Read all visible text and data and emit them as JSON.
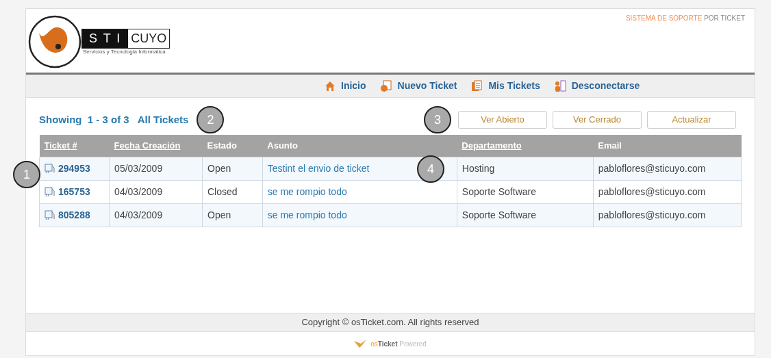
{
  "header": {
    "logo": {
      "letters": "S T I",
      "name": "CUYO",
      "tagline": "Servicios y Tecnologia Informatica"
    },
    "tagline_highlight": "SISTEMA DE SOPORTE",
    "tagline_rest": "POR TICKET"
  },
  "nav": [
    {
      "label": "Inicio"
    },
    {
      "label": "Nuevo Ticket"
    },
    {
      "label": "Mis Tickets"
    },
    {
      "label": "Desconectarse"
    }
  ],
  "summary": {
    "prefix": "Showing",
    "range": "1 - 3 of 3",
    "filter": "All Tickets"
  },
  "buttons": [
    "Ver Abierto",
    "Ver Cerrado",
    "Actualizar"
  ],
  "table": {
    "columns": [
      {
        "label": "Ticket #",
        "sortable": true
      },
      {
        "label": "Fecha Creación",
        "sortable": true
      },
      {
        "label": "Estado",
        "sortable": false
      },
      {
        "label": "Asunto",
        "sortable": false
      },
      {
        "label": "Departamento",
        "sortable": true
      },
      {
        "label": "Email",
        "sortable": false
      }
    ],
    "rows": [
      {
        "ticket": "294953",
        "date": "05/03/2009",
        "status": "Open",
        "subject": "Testint el envio de ticket",
        "department": "Hosting",
        "email": "pabloflores@sticuyo.com"
      },
      {
        "ticket": "165753",
        "date": "04/03/2009",
        "status": "Closed",
        "subject": "se me rompio todo",
        "department": "Soporte Software",
        "email": "pabloflores@sticuyo.com"
      },
      {
        "ticket": "805288",
        "date": "04/03/2009",
        "status": "Open",
        "subject": "se me rompio todo",
        "department": "Soporte Software",
        "email": "pabloflores@sticuyo.com"
      }
    ]
  },
  "callouts": [
    "1",
    "2",
    "3",
    "4"
  ],
  "footer": {
    "copyright": "Copyright © osTicket.com. All rights reserved",
    "powered": {
      "brand_prefix": "os",
      "brand": "Ticket",
      "suffix": "Powered"
    }
  }
}
